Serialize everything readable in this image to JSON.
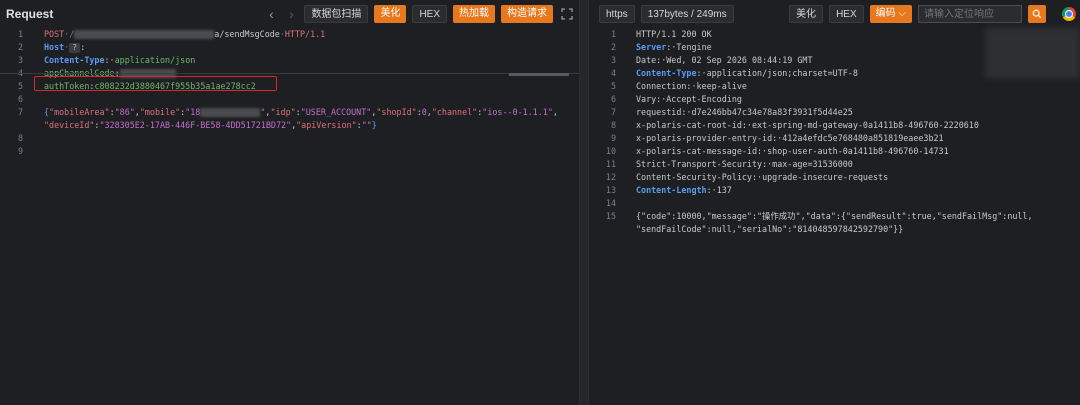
{
  "request": {
    "title": "Request",
    "buttons": [
      "数据包扫描",
      "美化",
      "HEX",
      "热加载",
      "构造请求"
    ],
    "lines": [
      {
        "n": "1",
        "method": "POST",
        "path_suffix": "/sendMsgCode",
        "protocol": "HTTP/1.1"
      },
      {
        "n": "2",
        "key": "Host",
        "value": ""
      },
      {
        "n": "3",
        "key": "Content-Type",
        "value": "application/json"
      },
      {
        "n": "4",
        "key": "appChannelCode",
        "value": ""
      },
      {
        "n": "5",
        "key": "authToken",
        "value": "c808232d3880467f955b35a1ae278cc2"
      },
      {
        "n": "6"
      },
      {
        "n": "7"
      },
      {
        "n": "8"
      },
      {
        "n": "9"
      }
    ],
    "body_line1": {
      "mobileArea_key": "\"mobileArea\"",
      "mobileArea_val": "\"86\"",
      "mobile_key": "\"mobile\"",
      "mobile_val_prefix": "\"18",
      "idp_key": "\"idp\"",
      "idp_val": "\"USER_ACCOUNT\"",
      "shopId_key": "\"shopId\"",
      "shopId_val": "0",
      "channel_key": "\"channel\"",
      "channel_val": "\"ios--0-1.1.1\""
    },
    "body_line2": {
      "deviceId_key": "\"deviceId\"",
      "deviceId_val": "\"328305E2-17AB-446F-BE58-4DD51721BD72\"",
      "apiVersion_key": "\"apiVersion\"",
      "apiVersion_val": "\"\""
    }
  },
  "response": {
    "scheme_button": "https",
    "size_button": "137bytes / 249ms",
    "buttons": [
      "美化",
      "HEX",
      "编码"
    ],
    "search_placeholder": "请输入定位响应",
    "lines": [
      {
        "n": "1",
        "text": "HTTP/1.1 200 OK"
      },
      {
        "n": "2",
        "key": "Server",
        "value": "Tengine"
      },
      {
        "n": "3",
        "key": "Date",
        "value": "Wed, 02 Sep 2026 08:44:19 GMT"
      },
      {
        "n": "4",
        "key": "Content-Type",
        "value": "application/json;charset=UTF-8"
      },
      {
        "n": "5",
        "key": "Connection",
        "value": "keep-alive"
      },
      {
        "n": "6",
        "key": "Vary",
        "value": "Accept-Encoding"
      },
      {
        "n": "7",
        "key": "requestid",
        "value": "d7e246bb47c34e78a83f3931f5d44e25"
      },
      {
        "n": "8",
        "key": "x-polaris-cat-root-id",
        "value": "ext-spring-md-gateway-0a1411b8-496760-2220610"
      },
      {
        "n": "9",
        "key": "x-polaris-provider-entry-id",
        "value": "412a4efdc5e768480a851819eaee3b21"
      },
      {
        "n": "10",
        "key": "x-polaris-cat-message-id",
        "value": "shop-user-auth-0a1411b8-496760-14731"
      },
      {
        "n": "11",
        "key": "Strict-Transport-Security",
        "value": "max-age=31536000"
      },
      {
        "n": "12",
        "key": "Content-Security-Policy",
        "value": "upgrade-insecure-requests"
      },
      {
        "n": "13",
        "key": "Content-Length",
        "value": "137"
      },
      {
        "n": "14"
      },
      {
        "n": "15"
      }
    ],
    "body_line1": "{\"code\":10000,\"message\":\"操作成功\",\"data\":{\"sendResult\":true,\"sendFailMsg\":null,",
    "body_line2": "\"sendFailCode\":null,\"serialNo\":\"814048597842592790\"}}"
  }
}
